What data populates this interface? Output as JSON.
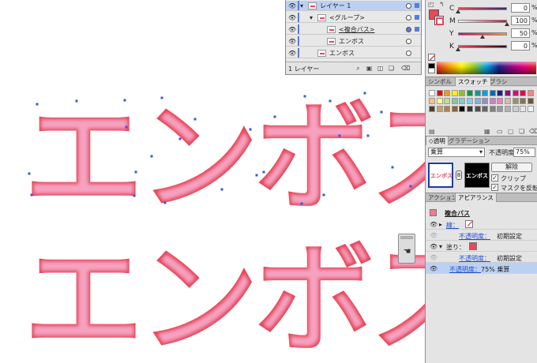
{
  "canvas": {
    "top_text": "エンボス",
    "bottom_text": "エンボス",
    "fill_color": "#f5a2c0",
    "edge_color": "#e8475c",
    "anchor_color": "#3b57d6"
  },
  "layers": {
    "rows": [
      {
        "name": "レイヤー 1",
        "indent": 0,
        "expanded": true
      },
      {
        "name": "<グループ>",
        "indent": 1,
        "expanded": true
      },
      {
        "name": "<複合パス>",
        "indent": 2,
        "expanded": false
      },
      {
        "name": "エンボス",
        "indent": 2,
        "expanded": false
      },
      {
        "name": "エンボス",
        "indent": 1,
        "expanded": false
      }
    ],
    "count_label": "1 レイヤー"
  },
  "color": {
    "channels": [
      {
        "label": "C",
        "value": "0",
        "unit": "%"
      },
      {
        "label": "M",
        "value": "100",
        "unit": "%"
      },
      {
        "label": "Y",
        "value": "50",
        "unit": "%"
      },
      {
        "label": "K",
        "value": "0",
        "unit": "%"
      }
    ],
    "fill_color": "#e8475c"
  },
  "swatch_tabs": {
    "tab1": "シンボル",
    "tab2": "スウォッチ",
    "tab3": "ブラシ"
  },
  "swatch_colors": [
    "#ffffff",
    "#e60012",
    "#f39800",
    "#fff100",
    "#8fc31f",
    "#009944",
    "#009e96",
    "#00a0e9",
    "#0068b7",
    "#1d2088",
    "#920783",
    "#e4007f",
    "#e5004f",
    "#ff7f7f",
    "#ffbf7f",
    "#ffff7f",
    "#c7e07f",
    "#7fcc9f",
    "#7fcfcb",
    "#7fd0f4",
    "#7fb4db",
    "#8e90c4",
    "#c883c1",
    "#f27fbf",
    "#d1c0a5",
    "#a58b6e",
    "#897156",
    "#6b563f",
    "#4c3d2c",
    "#c9a063",
    "#b28146",
    "#8c6239",
    "#000000",
    "#333333",
    "#4d4d4d",
    "#666666",
    "#808080",
    "#999999",
    "#b3b3b3",
    "#cccccc",
    "#e6e6e6",
    "#f2f2f2"
  ],
  "trans_tabs": {
    "tab1": "◇透明",
    "tab2": "グラデーション"
  },
  "transparency": {
    "blend_mode": "乗算",
    "opacity_label": "不透明度：",
    "opacity_value": "75%",
    "object_thumb_text": "エンボス",
    "mask_thumb_text": "エンボス",
    "release_button": "解除",
    "clip_label": "クリップ",
    "invert_mask_label": "マスクを反転",
    "clip_checked": true,
    "invert_checked": true
  },
  "appear_tabs": {
    "tab1": "アクション",
    "tab2": "アピアランス"
  },
  "appearance": {
    "header_title": "複合パス",
    "stroke_label": "線：",
    "stroke_opacity_label": "不透明度：",
    "stroke_opacity_value": "初期設定",
    "fill_label": "塗り：",
    "fill_opacity_label": "不透明度：",
    "fill_opacity_value": "初期設定",
    "object_opacity_label": "不透明度：",
    "object_opacity_value": "75% 乗算"
  }
}
